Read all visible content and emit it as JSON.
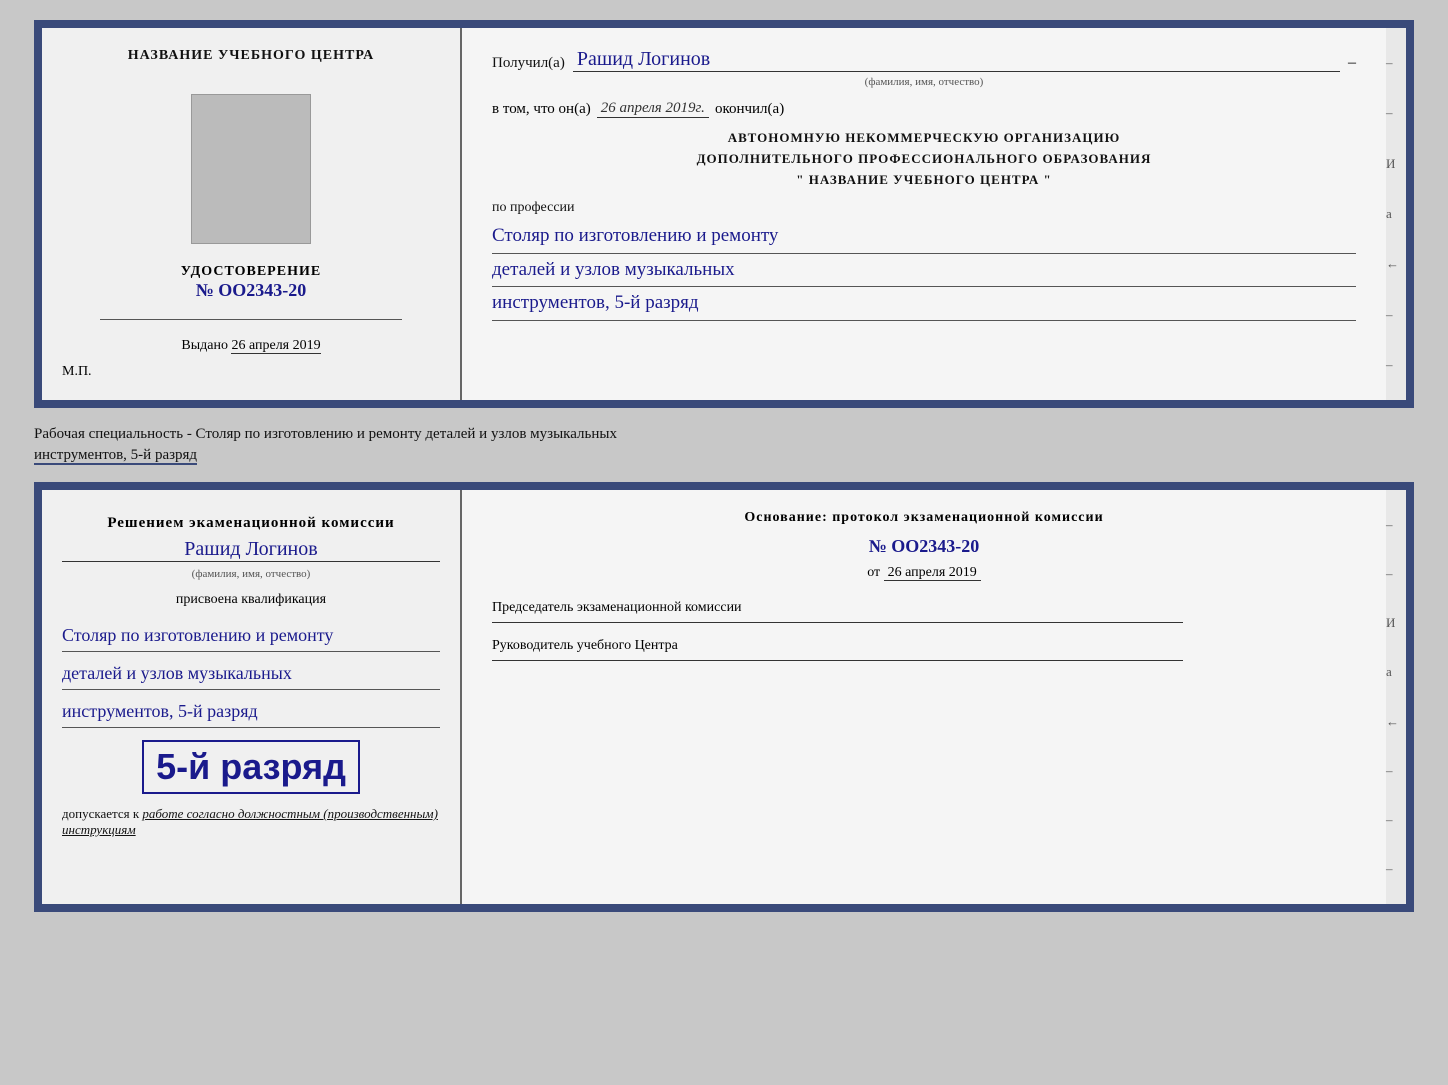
{
  "topDoc": {
    "leftTitle": "НАЗВАНИЕ УЧЕБНОГО ЦЕНТРА",
    "udostoverenie": "УДОСТОВЕРЕНИЕ",
    "number": "№ OO2343-20",
    "vydano": "Выдано",
    "vydanoDate": "26 апреля 2019",
    "mp": "М.П.",
    "recipientLabel": "Получил(а)",
    "recipientName": "Рашид Логинов",
    "fioSubtitle": "(фамилия, имя, отчество)",
    "dash": "–",
    "vTomLabel": "в том, что он(а)",
    "vTomDate": "26 апреля 2019г.",
    "okonchil": "окончил(а)",
    "orgLine1": "АВТОНОМНУЮ НЕКОММЕРЧЕСКУЮ ОРГАНИЗАЦИЮ",
    "orgLine2": "ДОПОЛНИТЕЛЬНОГО ПРОФЕССИОНАЛЬНОГО ОБРАЗОВАНИЯ",
    "orgLine3": "\"  НАЗВАНИЕ УЧЕБНОГО ЦЕНТРА  \"",
    "poProfessii": "по профессии",
    "professionLine1": "Столяр по изготовлению и ремонту",
    "professionLine2": "деталей и узлов музыкальных",
    "professionLine3": "инструментов, 5-й разряд"
  },
  "betweenLabel": {
    "text": "Рабочая специальность - Столяр по изготовлению и ремонту деталей и узлов музыкальных",
    "textUnderline": "инструментов, 5-й разряд"
  },
  "bottomDoc": {
    "resheniemLabel": "Решением экаменационной комиссии",
    "name": "Рашид Логинов",
    "fioSubtitle": "(фамилия, имя, отчество)",
    "prisvoenaLabel": "присвоена квалификация",
    "professionLine1": "Столяр по изготовлению и ремонту",
    "professionLine2": "деталей и узлов музыкальных",
    "professionLine3": "инструментов, 5-й разряд",
    "razryadBig": "5-й разряд",
    "dopuskaetsyaLabel": "допускается к",
    "dopuskaetsyaText": "работе согласно должностным (производственным) инструкциям",
    "osnovanie": "Основание: протокол экзаменационной комиссии",
    "protocolNumber": "№ OO2343-20",
    "otLabel": "от",
    "otDate": "26 апреля 2019",
    "predsedatelLabel": "Председатель экзаменационной комиссии",
    "rukovoditelLabel": "Руководитель учебного Центра",
    "sideChars": [
      "И",
      "а",
      "←",
      "–",
      "–",
      "–",
      "–",
      "–"
    ]
  }
}
